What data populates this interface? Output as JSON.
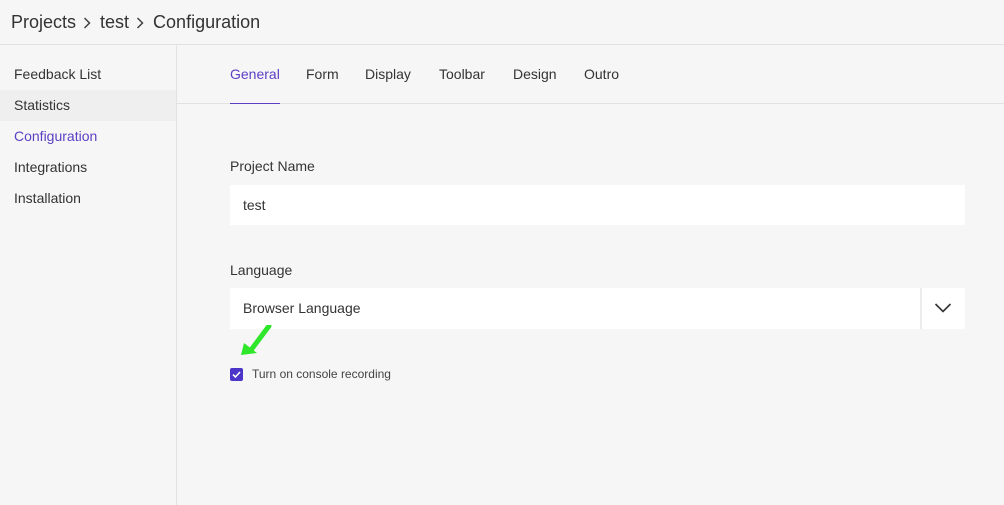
{
  "breadcrumb": {
    "items": [
      "Projects",
      "test",
      "Configuration"
    ]
  },
  "sidebar": {
    "items": [
      {
        "label": "Feedback List"
      },
      {
        "label": "Statistics"
      },
      {
        "label": "Configuration"
      },
      {
        "label": "Integrations"
      },
      {
        "label": "Installation"
      }
    ],
    "active": "Configuration"
  },
  "tabs": {
    "items": [
      {
        "label": "General"
      },
      {
        "label": "Form"
      },
      {
        "label": "Display"
      },
      {
        "label": "Toolbar"
      },
      {
        "label": "Design"
      },
      {
        "label": "Outro"
      }
    ],
    "active": "General"
  },
  "form": {
    "project_name_label": "Project Name",
    "project_name_value": "test",
    "language_label": "Language",
    "language_value": "Browser Language",
    "console_recording_label": "Turn on console recording",
    "console_recording_checked": true
  },
  "colors": {
    "accent": "#5b3fc4",
    "checkbox": "#4a35c8",
    "annotation_arrow": "#2ee62a"
  },
  "icons": {
    "breadcrumb_separator": "chevron-right-icon",
    "select_toggle": "chevron-down-icon",
    "checkbox": "checkmark-icon",
    "annotation": "green-arrow-icon"
  }
}
